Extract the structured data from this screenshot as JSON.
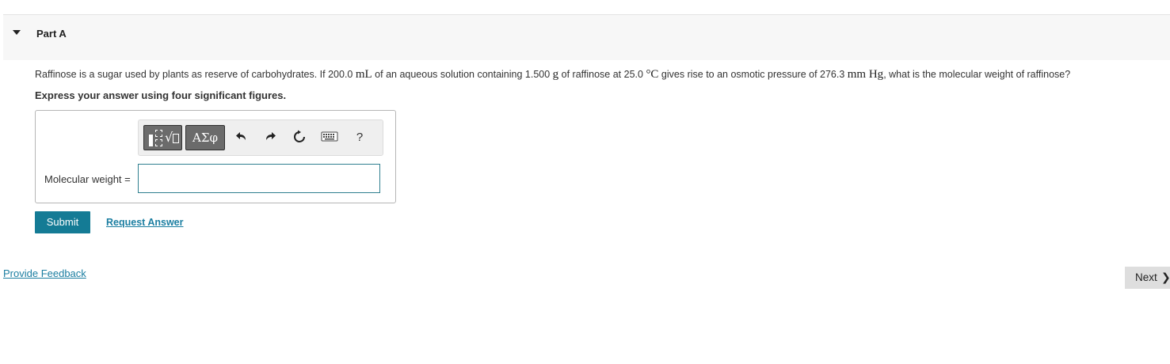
{
  "part": {
    "title": "Part A",
    "caret_icon": "caret-down-icon"
  },
  "question": {
    "t1": "Raffinose is a sugar used by plants as reserve of carbohydrates. If 200.0 ",
    "u1": "mL",
    "t2": " of an aqueous solution containing 1.500 ",
    "u2": "g",
    "t3": " of raffinose at 25.0 ",
    "u3": "°C",
    "t4": " gives rise to an osmotic pressure of 276.3 ",
    "u4": "mm Hg",
    "t5": ", what is the molecular weight of raffinose?",
    "instruction": "Express your answer using four significant figures."
  },
  "toolbar": {
    "templates_icon": "templates-icon",
    "symbols_label": "ΑΣφ",
    "undo_icon": "undo-icon",
    "redo_icon": "redo-icon",
    "reset_icon": "reset-icon",
    "keyboard_icon": "keyboard-icon",
    "help_label": "?"
  },
  "answer": {
    "label": "Molecular weight =",
    "value": ""
  },
  "actions": {
    "submit_label": "Submit",
    "request_label": "Request Answer"
  },
  "footer": {
    "feedback_label": "Provide Feedback",
    "next_label": "Next",
    "next_icon": "chevron-right-icon"
  },
  "colors": {
    "accent": "#147b95",
    "link": "#1b7ea1",
    "header_bg": "#f7f7f7",
    "toolbar_button": "#6b6b6b"
  }
}
